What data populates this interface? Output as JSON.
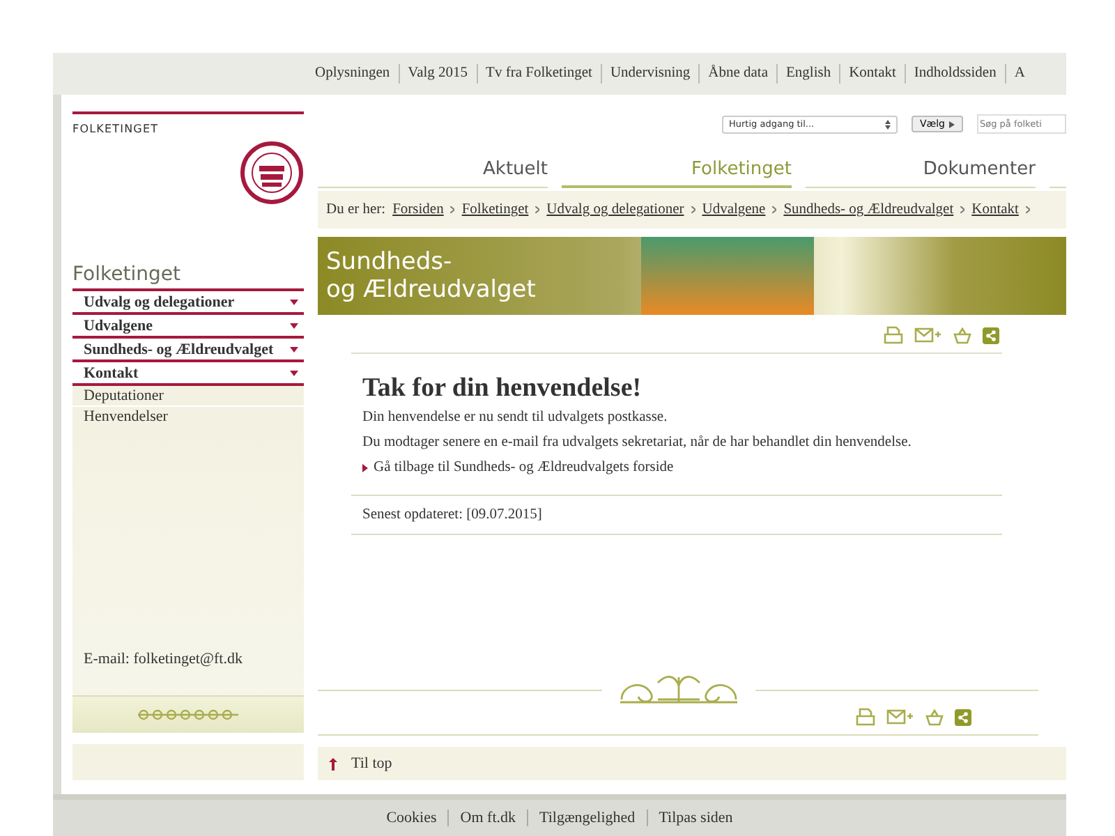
{
  "top_links": [
    "Oplysningen",
    "Valg 2015",
    "Tv fra Folketinget",
    "Undervisning",
    "Åbne data",
    "English",
    "Kontakt",
    "Indholdssiden",
    "A"
  ],
  "logo": {
    "name": "FOLKETINGET"
  },
  "quick_access": {
    "value": "Hurtig adgang til...",
    "button": "Vælg"
  },
  "search": {
    "placeholder": "Søg på folketi"
  },
  "main_tabs": [
    {
      "label": "Aktuelt",
      "selected": false
    },
    {
      "label": "Folketinget",
      "selected": true
    },
    {
      "label": "Dokumenter",
      "selected": false
    }
  ],
  "breadcrumb": {
    "label": "Du er her:",
    "items": [
      "Forsiden",
      "Folketinget",
      "Udvalg og delegationer",
      "Udvalgene",
      "Sundheds- og Ældreudvalget",
      "Kontakt"
    ]
  },
  "sidebar": {
    "title": "Folketinget",
    "items": [
      {
        "label": "Udvalg og delegationer",
        "kind": "section"
      },
      {
        "label": "Udvalgene",
        "kind": "section"
      },
      {
        "label": "Sundheds- og Ældreudvalget",
        "kind": "section"
      },
      {
        "label": "Kontakt",
        "kind": "section"
      },
      {
        "label": "Deputationer",
        "kind": "sub"
      },
      {
        "label": "Henvendelser",
        "kind": "sub"
      }
    ],
    "email": "E-mail: folketinget@ft.dk"
  },
  "banner": {
    "title_line1": "Sundheds-",
    "title_line2": "og Ældreudvalget"
  },
  "content": {
    "heading": "Tak for din henvendelse!",
    "paragraphs": [
      "Din henvendelse er nu sendt til udvalgets postkasse.",
      "Du modtager senere en e-mail fra udvalgets sekretariat, når de har behandlet din henvendelse."
    ],
    "back_link": "Gå tilbage til Sundheds- og Ældreudvalgets forside",
    "updated": "Senest opdateret: [09.07.2015]"
  },
  "to_top": "Til top",
  "footer_links": [
    "Cookies",
    "Om ft.dk",
    "Tilgængelighed",
    "Tilpas siden"
  ]
}
